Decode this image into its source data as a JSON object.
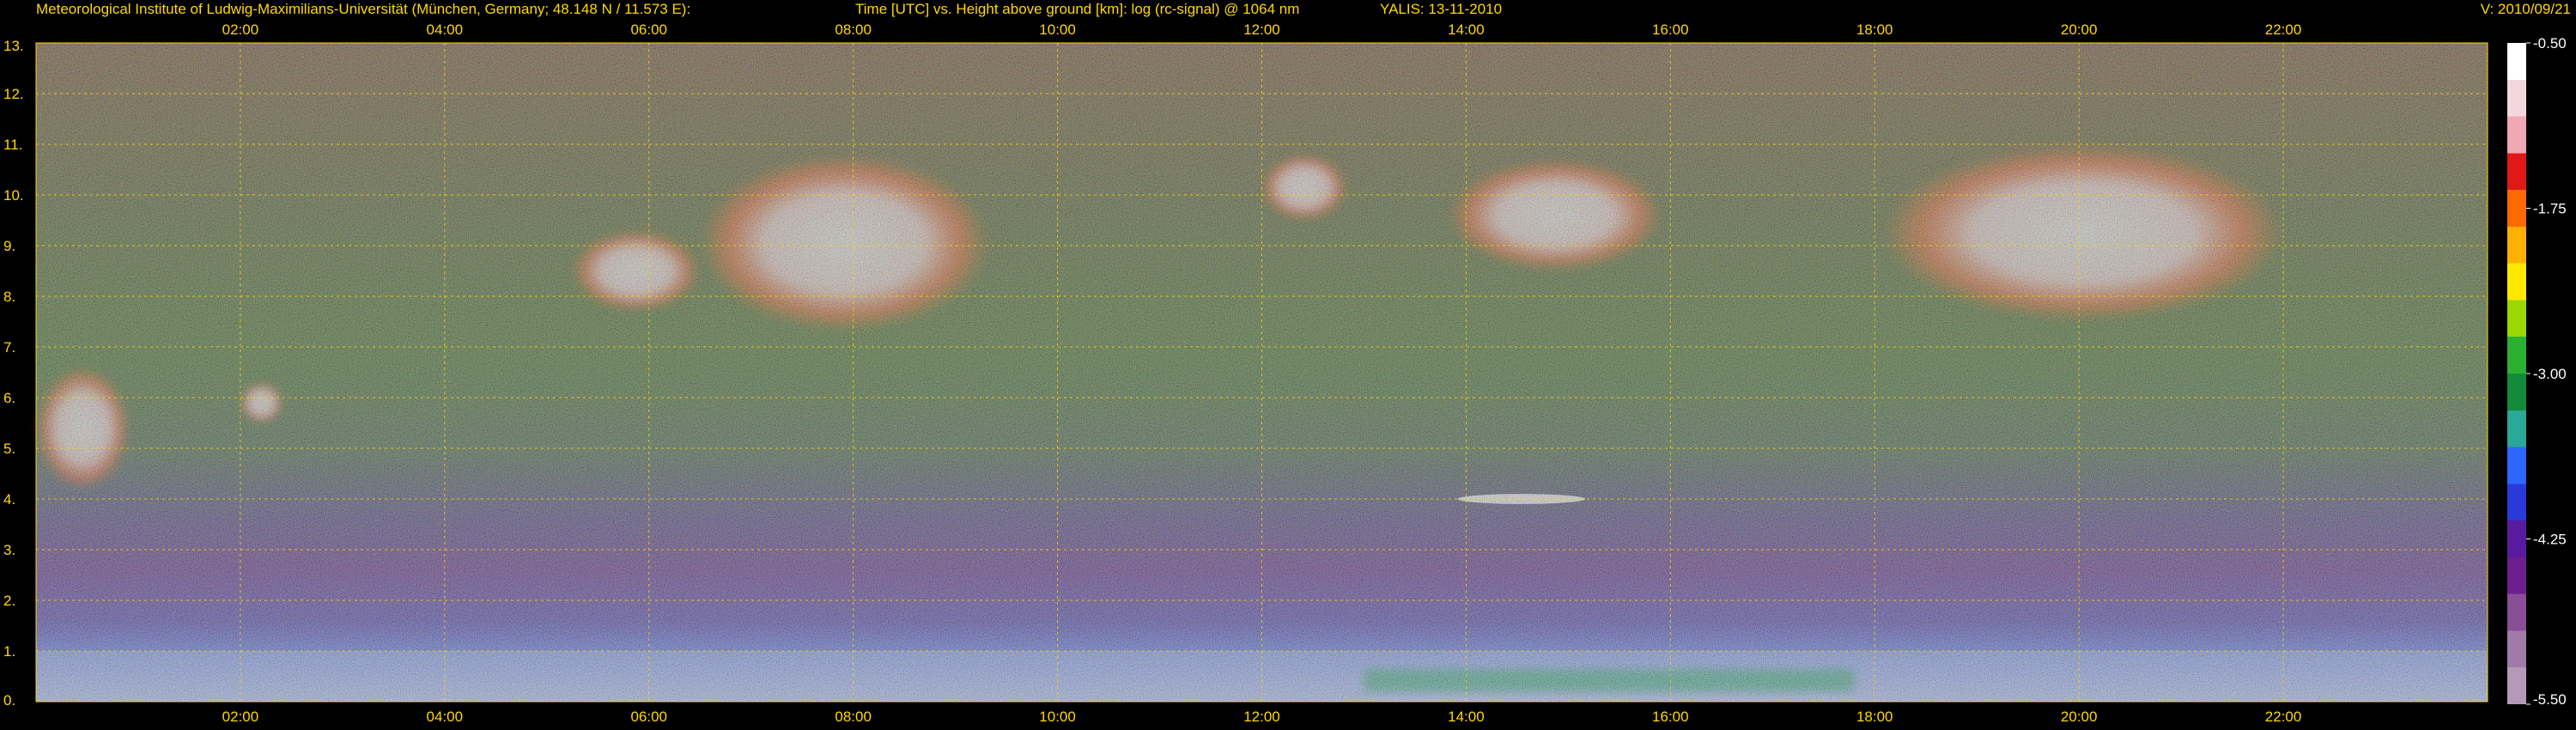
{
  "header": {
    "institute": "Meteorological Institute of Ludwig-Maximilians-Universität (München, Germany; 48.148 N / 11.573 E):",
    "plot_title": "Time [UTC] vs. Height above ground [km]: log (rc-signal) @ 1064 nm",
    "instrument_date": "YALIS: 13-11-2010",
    "version": "V: 2010/09/21"
  },
  "colors": {
    "text": "#ffd800",
    "background": "#000000",
    "grid": "#ffd800"
  },
  "chart_data": {
    "type": "heatmap",
    "title": "Time [UTC] vs. Height above ground [km]: log (rc-signal) @ 1064 nm",
    "xlabel": "Time [UTC]",
    "ylabel": "Height above ground [km]",
    "x_range_utc_hours": [
      0,
      24
    ],
    "xlim": [
      "00:00",
      "24:00"
    ],
    "x_ticks": [
      "02:00",
      "04:00",
      "06:00",
      "08:00",
      "10:00",
      "12:00",
      "14:00",
      "16:00",
      "18:00",
      "20:00",
      "22:00"
    ],
    "ylim": [
      0,
      13
    ],
    "y_ticks": [
      "0.",
      "1.",
      "2.",
      "3.",
      "4.",
      "5.",
      "6.",
      "7.",
      "8.",
      "9.",
      "10.",
      "11.",
      "12.",
      "13."
    ],
    "grid": true,
    "colorbar": {
      "range": [
        -5.5,
        -0.5
      ],
      "tick_labels": [
        "-0.50",
        "-1.75",
        "-3.00",
        "-4.25",
        "-5.50"
      ],
      "colors": [
        "#ffffff",
        "#f2d8dc",
        "#f0a8b4",
        "#e01818",
        "#ff6a00",
        "#ffb000",
        "#ffe800",
        "#9ad800",
        "#2cb030",
        "#128a3a",
        "#2aa898",
        "#2f66ff",
        "#2a3ad8",
        "#5a1aa0",
        "#6c1f8c",
        "#8a4e96",
        "#a07aa8",
        "#b49ab8"
      ]
    },
    "features": [
      {
        "type": "cloud",
        "start": "00:00",
        "end": "00:55",
        "base_km": 4.2,
        "top_km": 6.6
      },
      {
        "type": "cloud",
        "start": "02:00",
        "end": "02:25",
        "base_km": 5.5,
        "top_km": 6.3
      },
      {
        "type": "cloud",
        "start": "05:15",
        "end": "06:30",
        "base_km": 7.7,
        "top_km": 9.3
      },
      {
        "type": "cloud",
        "start": "06:30",
        "end": "09:20",
        "base_km": 7.3,
        "top_km": 10.8
      },
      {
        "type": "cloud",
        "start": "12:00",
        "end": "12:50",
        "base_km": 9.5,
        "top_km": 10.8
      },
      {
        "type": "cloud",
        "start": "13:50",
        "end": "15:55",
        "base_km": 8.5,
        "top_km": 10.7
      },
      {
        "type": "cloud",
        "start": "18:05",
        "end": "22:00",
        "base_km": 7.5,
        "top_km": 11.0
      },
      {
        "type": "thin_layer",
        "start": "13:55",
        "end": "15:10",
        "base_km": 3.9,
        "top_km": 4.1
      },
      {
        "type": "boundary_layer",
        "start": "00:00",
        "end": "24:00",
        "base_km": 0,
        "top_km": 1.0
      }
    ]
  }
}
